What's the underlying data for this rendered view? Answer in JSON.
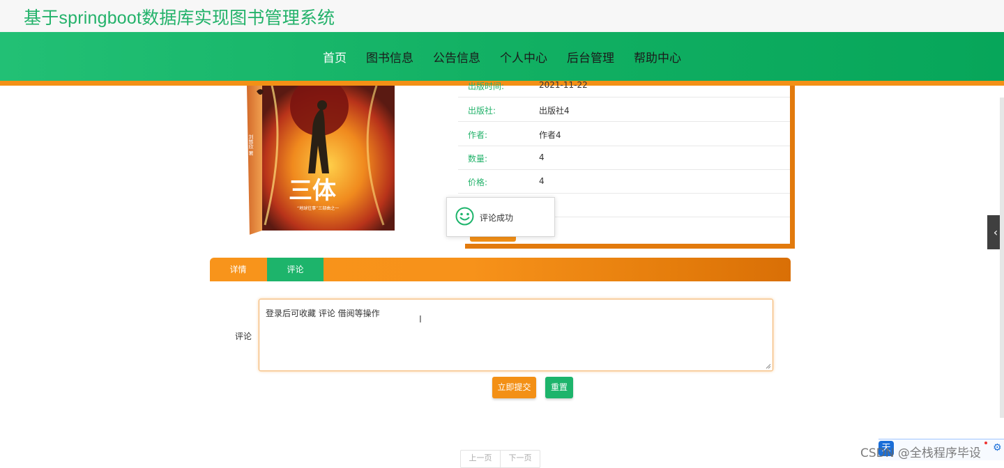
{
  "header": {
    "title": "基于springboot数据库实现图书管理系统"
  },
  "nav": {
    "items": [
      {
        "label": "首页",
        "active": true
      },
      {
        "label": "图书信息",
        "active": false
      },
      {
        "label": "公告信息",
        "active": false
      },
      {
        "label": "个人中心",
        "active": false
      },
      {
        "label": "后台管理",
        "active": false
      },
      {
        "label": "帮助中心",
        "active": false
      }
    ]
  },
  "book": {
    "cover_text": "三体",
    "cover_vertical": "刘慈欣 著",
    "cover_tagline": "“地球往事”三部曲之一",
    "details": [
      {
        "key": "出版时间:",
        "value": "2021-11-22"
      },
      {
        "key": "出版社:",
        "value": "出版社4"
      },
      {
        "key": "作者:",
        "value": "作者4"
      },
      {
        "key": "数量:",
        "value": "4"
      },
      {
        "key": "价格:",
        "value": "4"
      }
    ]
  },
  "toast": {
    "message": "评论成功"
  },
  "tabs": [
    {
      "label": "详情",
      "active": false
    },
    {
      "label": "评论",
      "active": true
    }
  ],
  "comment": {
    "label": "评论",
    "value": "登录后可收藏 评论 借阅等操作",
    "submit_label": "立即提交",
    "reset_label": "重置"
  },
  "pager": {
    "prev": "上一页",
    "next": "下一页"
  },
  "watermark": {
    "text": "CSDN @全栈程序毕设"
  },
  "float_bar": {
    "badge": "天"
  },
  "colors": {
    "primary_green": "#1db46b",
    "accent_orange": "#f39016",
    "title_green": "#23b26a"
  },
  "icons": {
    "toast": "smile-icon",
    "side_toggle": "chevron-left-icon"
  }
}
